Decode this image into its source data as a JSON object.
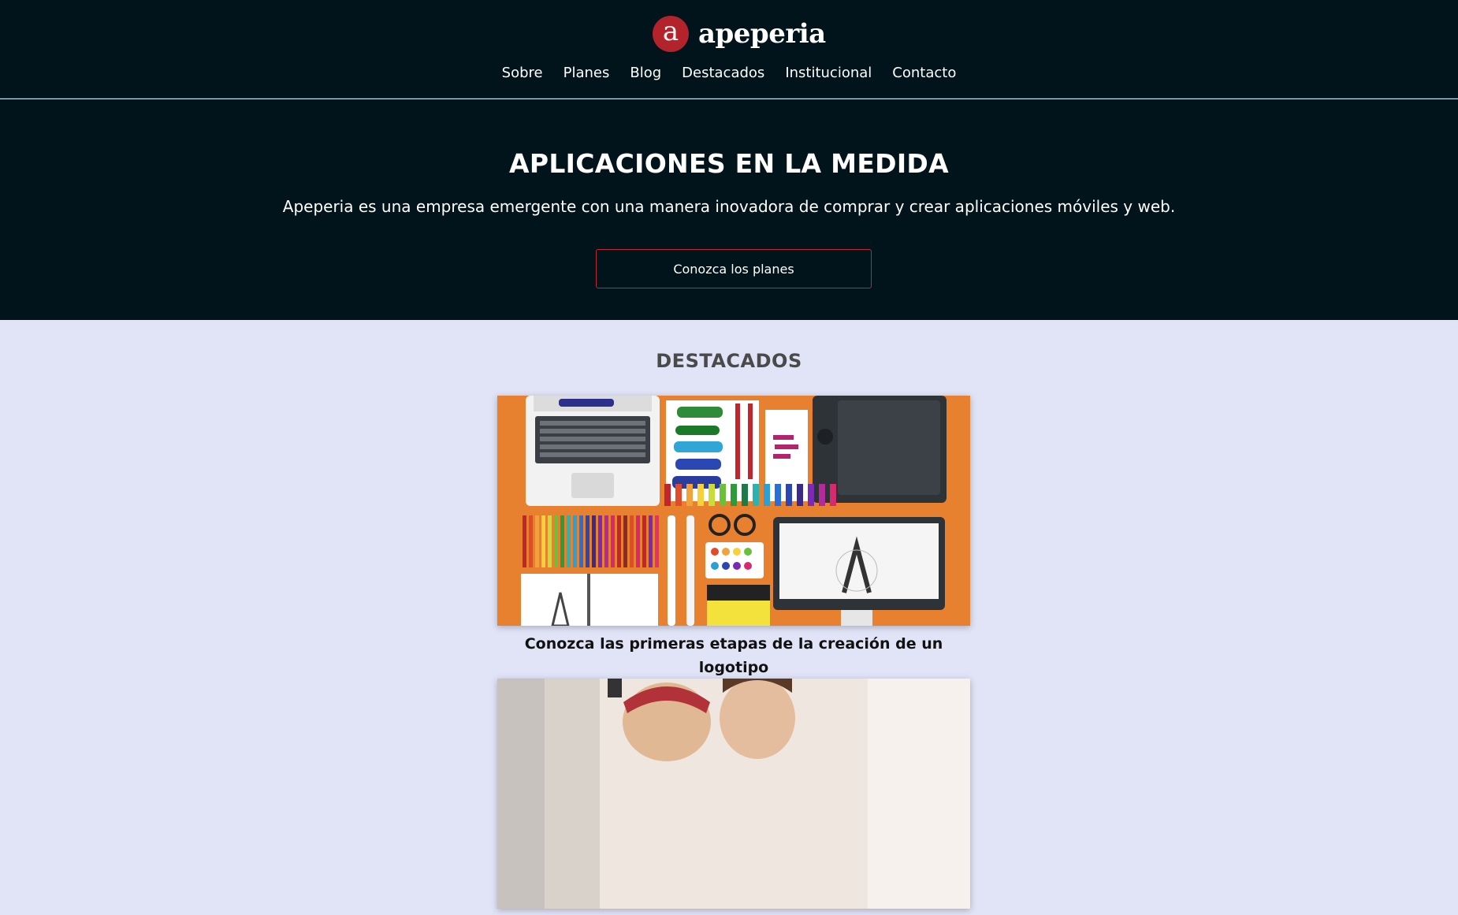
{
  "header": {
    "logo_letter": "a",
    "brand_name": "apeperia",
    "nav": [
      "Sobre",
      "Planes",
      "Blog",
      "Destacados",
      "Institucional",
      "Contacto"
    ]
  },
  "hero": {
    "title": "APLICACIONES EN LA MEDIDA",
    "subtitle": "Apeperia es una empresa emergente con una manera inovadora de comprar y crear aplicaciones móviles y web.",
    "cta_label": "Conozca los planes"
  },
  "featured": {
    "heading": "DESTACADOS",
    "cards": [
      {
        "title": "Conozca las primeras etapas de la creación de un logotipo"
      },
      {
        "title": ""
      }
    ]
  },
  "colors": {
    "header_bg": "#01141c",
    "accent": "#b3232b",
    "section_bg": "#e1e3f7",
    "card1_bg": "#e8812f"
  }
}
